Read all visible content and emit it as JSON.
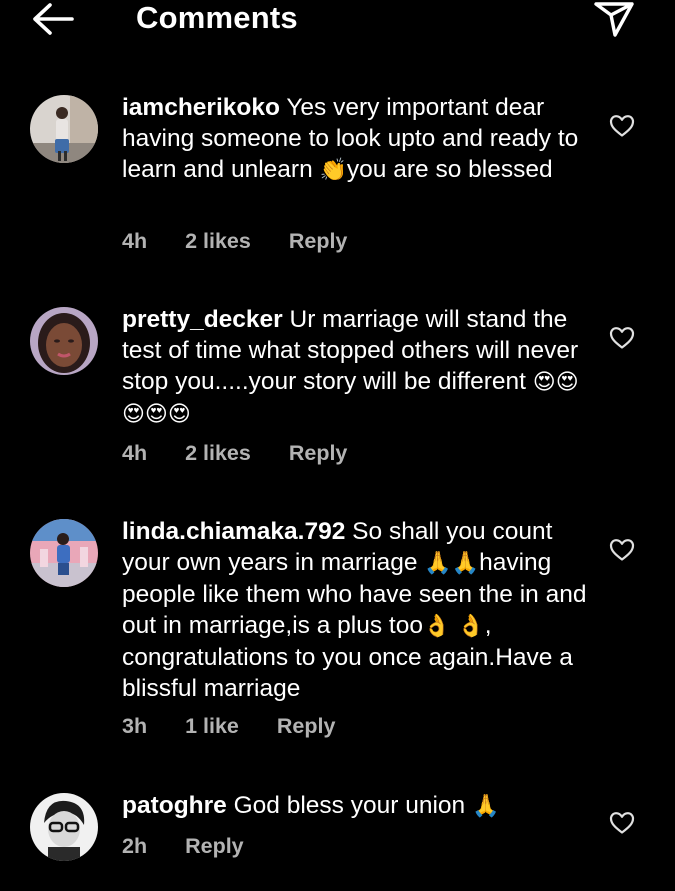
{
  "header": {
    "title": "Comments",
    "back_icon": "arrow-left-icon",
    "send_icon": "paper-plane-icon"
  },
  "comments": [
    {
      "username": "iamcherikoko",
      "text_before": " Yes very important dear having someone to look upto and ready to learn and unlearn ",
      "emoji_1": "👏",
      "text_after": "you are so blessed",
      "time": "4h",
      "likes": "2 likes",
      "reply": "Reply"
    },
    {
      "username": "pretty_decker",
      "text_before": " Ur marriage will stand the test of time what stopped others will never stop you.....your story will be different ",
      "emoji_1": "😍😍😍😍😍",
      "text_after": "",
      "time": "4h",
      "likes": "2 likes",
      "reply": "Reply"
    },
    {
      "username": "linda.chiamaka.792",
      "text_before": " So shall you count your own years in marriage ",
      "emoji_1": "🙏🙏",
      "text_mid": "having people like them who have seen the in and out in marriage,is a plus too",
      "emoji_2": "👌 👌",
      "text_after": ", congratulations to you once again.Have a blissful marriage",
      "time": "3h",
      "likes": "1 like",
      "reply": "Reply"
    },
    {
      "username": "patoghre",
      "text_before": " God bless your union ",
      "emoji_1": "🙏",
      "text_after": "",
      "time": "2h",
      "reply": "Reply"
    }
  ],
  "colors": {
    "background": "#000000",
    "text": "#ffffff",
    "meta": "#b3b3b3"
  }
}
